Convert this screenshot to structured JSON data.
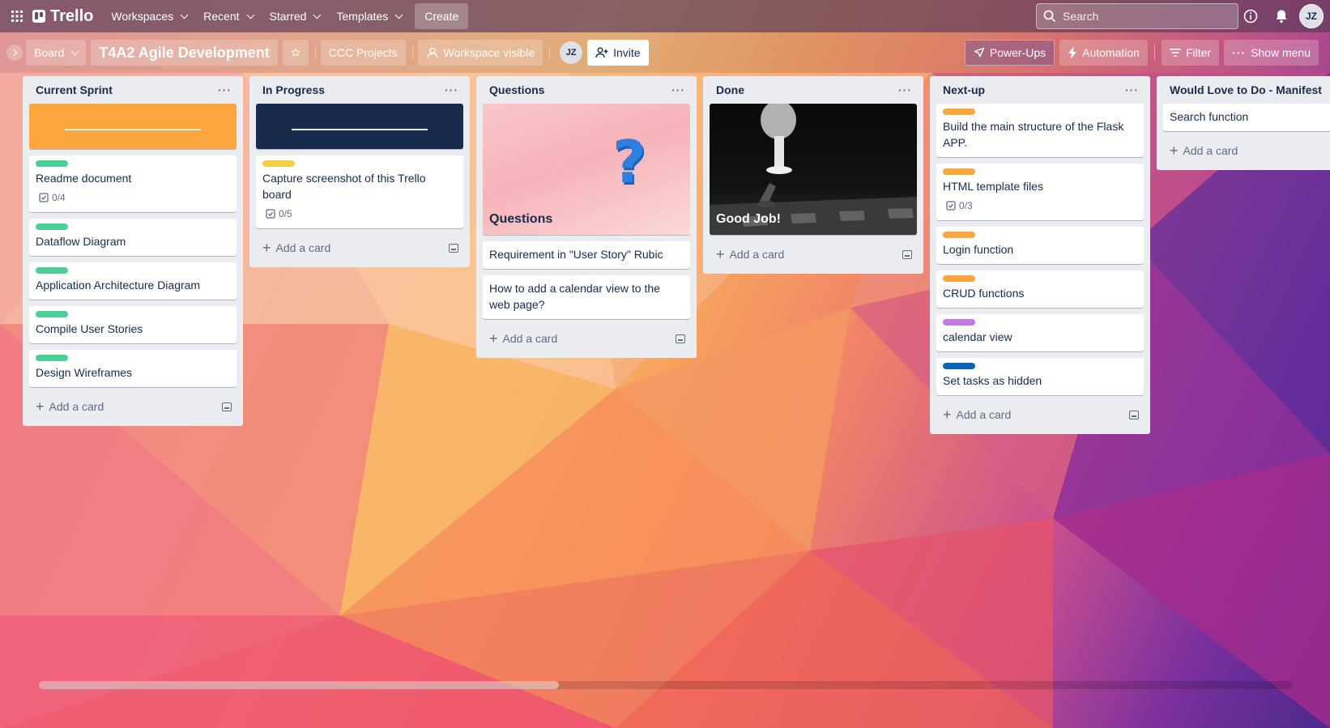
{
  "topnav": {
    "brand": "Trello",
    "menus": [
      "Workspaces",
      "Recent",
      "Starred",
      "Templates"
    ],
    "create_label": "Create",
    "search_placeholder": "Search",
    "user_initials": "JZ"
  },
  "board": {
    "view_label": "Board",
    "title": "T4A2 Agile Development",
    "workspace_name": "CCC Projects",
    "visibility_label": "Workspace visible",
    "member_initials": "JZ",
    "invite_label": "Invite",
    "powerups_label": "Power-Ups",
    "automation_label": "Automation",
    "filter_label": "Filter",
    "show_menu_label": "Show menu"
  },
  "colors": {
    "green": "#61bd4f",
    "green_label": "#4bce97",
    "yellow": "#f5cd47",
    "orange": "#faa53d",
    "purple": "#c377e0",
    "blue": "#0c66b4",
    "navy": "#172b4d"
  },
  "lists": [
    {
      "title": "Current Sprint",
      "cards": [
        {
          "label": "Readme document",
          "badge": "0/4",
          "label_color": "#4bce97"
        },
        {
          "label": "Dataflow Diagram",
          "label_color": "#4bce97"
        },
        {
          "label": "Application Architecture Diagram",
          "label_color": "#4bce97"
        },
        {
          "label": "Compile User Stories",
          "label_color": "#4bce97"
        },
        {
          "label": "Design Wireframes",
          "label_color": "#4bce97"
        }
      ],
      "add_label": "Add a card"
    },
    {
      "title": "In Progress",
      "cards": [
        {
          "label": "Capture screenshot of this Trello board",
          "badge": "0/5",
          "label_color": "#f5cd47"
        }
      ],
      "add_label": "Add a card"
    },
    {
      "title": "Questions",
      "cover_title": "Questions",
      "cards": [
        {
          "label": "Requirement in \"User Story\" Rubic"
        },
        {
          "label": "How to add a calendar view to the web page?"
        }
      ],
      "add_label": "Add a card"
    },
    {
      "title": "Done",
      "cover_title": "Good Job!",
      "add_label": "Add a card"
    },
    {
      "title": "Next-up",
      "cards": [
        {
          "label": "Build the main structure of the Flask APP.",
          "label_color": "#faa53d"
        },
        {
          "label": "HTML template files",
          "badge": "0/3",
          "label_color": "#faa53d"
        },
        {
          "label": "Login function",
          "label_color": "#faa53d"
        },
        {
          "label": "CRUD functions",
          "label_color": "#faa53d"
        },
        {
          "label": "calendar view",
          "label_color": "#c377e0"
        },
        {
          "label": "Set tasks as hidden",
          "label_color": "#0c66b4"
        }
      ],
      "add_label": "Add a card"
    },
    {
      "title": "Would Love to Do - Manifest",
      "cards": [
        {
          "label": "Search function"
        }
      ],
      "add_label": "Add a card"
    }
  ]
}
